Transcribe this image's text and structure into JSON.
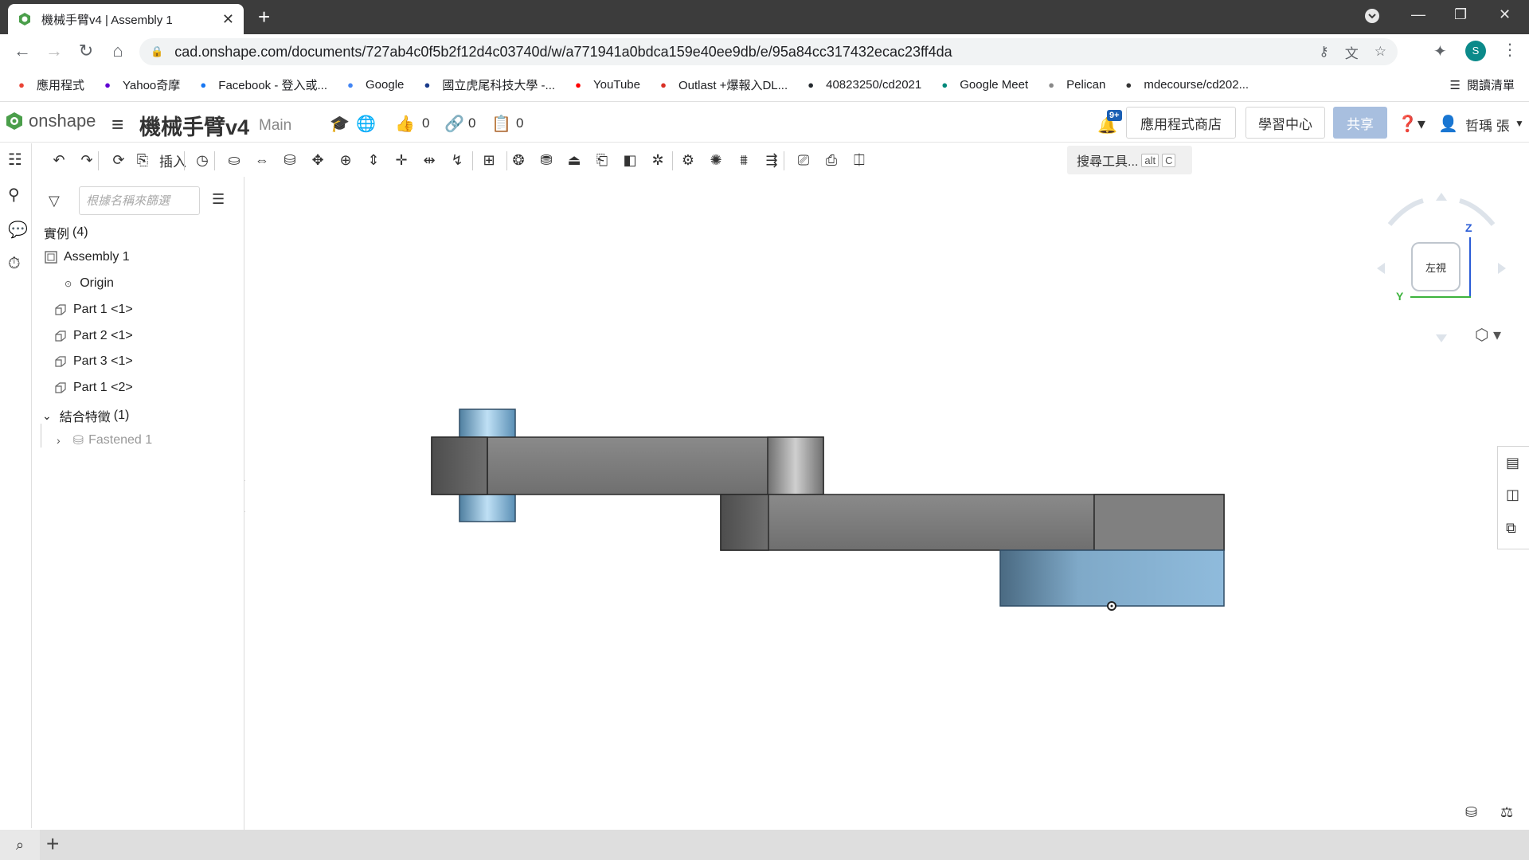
{
  "browser": {
    "tab_title": "機械手臂v4 | Assembly 1",
    "url": "cad.onshape.com/documents/727ab4c0f5b2f12d4c03740d/w/a771941a0bdca159e40ee9db/e/95a84cc317432ecac23ff4da",
    "profile_initial": "S",
    "bookmarks": [
      {
        "label": "應用程式",
        "icon": "apps-grid-icon",
        "color": "#ea4335"
      },
      {
        "label": "Yahoo奇摩",
        "icon": "yahoo-icon",
        "color": "#6001d2"
      },
      {
        "label": "Facebook - 登入或...",
        "icon": "facebook-icon",
        "color": "#1877f2"
      },
      {
        "label": "Google",
        "icon": "google-icon",
        "color": "#4285f4"
      },
      {
        "label": "國立虎尾科技大學 -...",
        "icon": "nfu-icon",
        "color": "#1a3b8a"
      },
      {
        "label": "YouTube",
        "icon": "youtube-icon",
        "color": "#ff0000"
      },
      {
        "label": "Outlast +爆報入DL...",
        "icon": "outlast-icon",
        "color": "#d93025"
      },
      {
        "label": "40823250/cd2021",
        "icon": "github-icon",
        "color": "#24292e"
      },
      {
        "label": "Google Meet",
        "icon": "meet-icon",
        "color": "#00897b"
      },
      {
        "label": "Pelican",
        "icon": "pelican-icon",
        "color": "#888888"
      },
      {
        "label": "mdecourse/cd202...",
        "icon": "mde-icon",
        "color": "#333333"
      }
    ],
    "reading_list": "閱讀清單"
  },
  "header": {
    "logo": "onshape",
    "doc_name": "機械手臂v4",
    "branch": "Main",
    "likes": "0",
    "links": "0",
    "copies": "0",
    "notif_badge": "9+",
    "app_store": "應用程式商店",
    "learning": "學習中心",
    "share": "共享",
    "user": "哲瑀 張"
  },
  "toolbar": {
    "insert_label": "插入",
    "search_label": "搜尋工具...",
    "shortcut_alt": "alt",
    "shortcut_c": "C"
  },
  "panel": {
    "filter_placeholder": "根據名稱來篩選",
    "instances_label": "實例",
    "instances_count": "(4)",
    "assembly": "Assembly 1",
    "origin": "Origin",
    "parts": [
      "Part 1 <1>",
      "Part 2 <1>",
      "Part 3 <1>",
      "Part 1 <2>"
    ],
    "mates_label": "結合特徵",
    "mates_count": "(1)",
    "mate": "Fastened 1"
  },
  "viewcube": {
    "face": "左視",
    "z": "Z",
    "y": "Y",
    "z_color": "#2a5cd6",
    "y_color": "#3db33d"
  },
  "colors": {
    "gray_part": "#7d7d7d",
    "blue_part": "#7fb3d5"
  }
}
